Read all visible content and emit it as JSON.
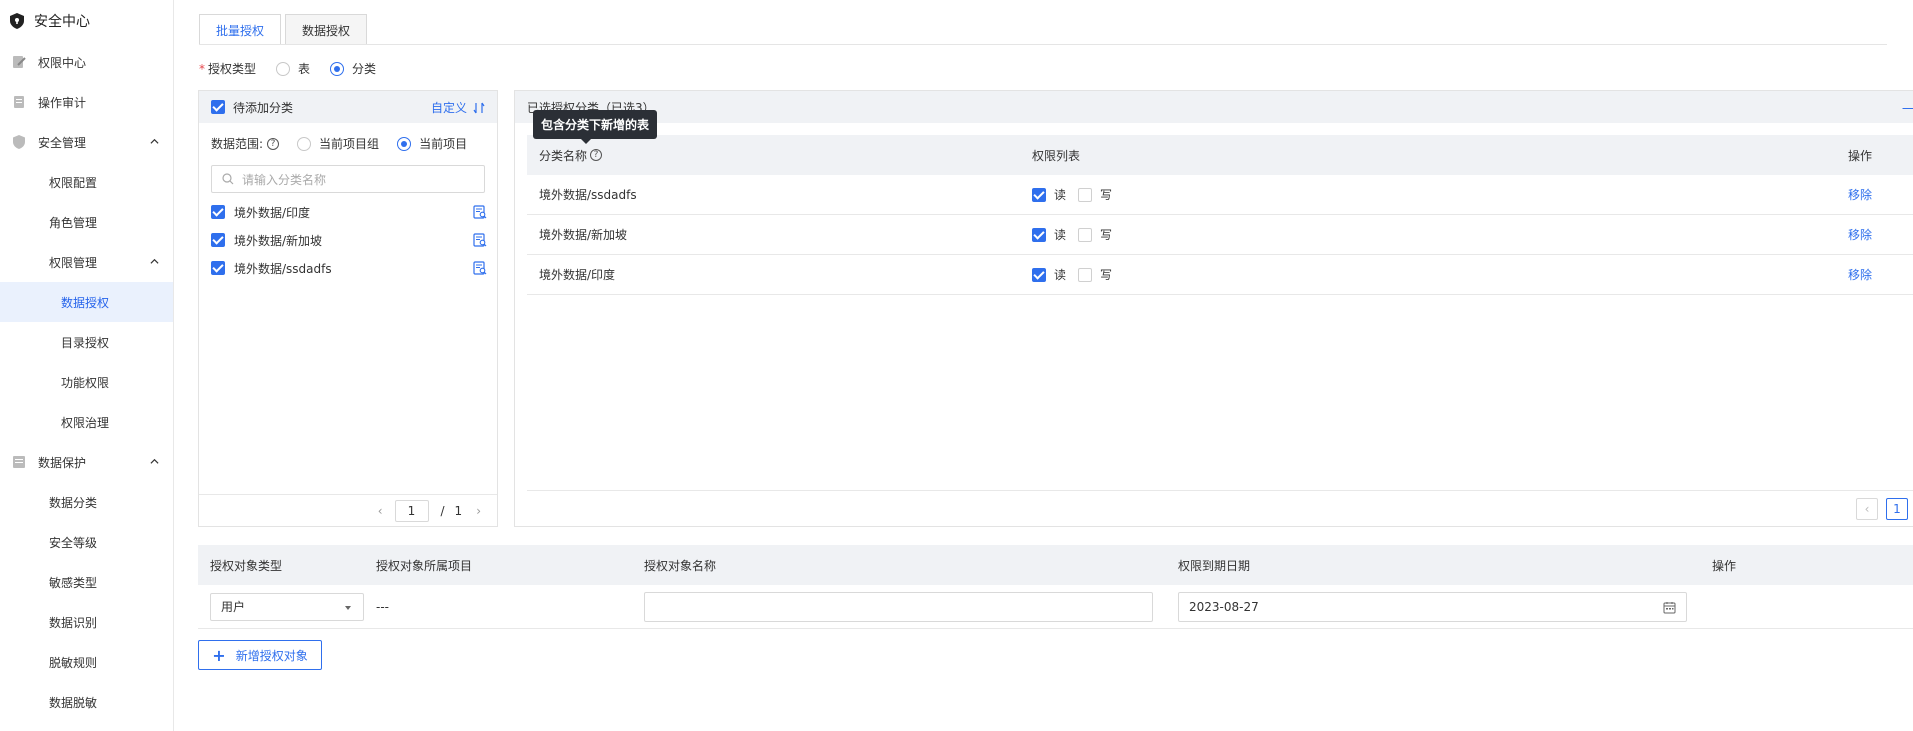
{
  "sidebar": {
    "title": "安全中心",
    "items": [
      {
        "label": "权限中心"
      },
      {
        "label": "操作审计"
      },
      {
        "label": "安全管理"
      },
      {
        "label": "权限配置"
      },
      {
        "label": "角色管理"
      },
      {
        "label": "权限管理"
      },
      {
        "label": "数据授权"
      },
      {
        "label": "目录授权"
      },
      {
        "label": "功能权限"
      },
      {
        "label": "权限治理"
      },
      {
        "label": "数据保护"
      },
      {
        "label": "数据分类"
      },
      {
        "label": "安全等级"
      },
      {
        "label": "敏感类型"
      },
      {
        "label": "数据识别"
      },
      {
        "label": "脱敏规则"
      },
      {
        "label": "数据脱敏"
      }
    ]
  },
  "tabs": [
    {
      "label": "批量授权"
    },
    {
      "label": "数据授权"
    }
  ],
  "auth_type": {
    "required": "*",
    "label": "授权类型",
    "opt_table": "表",
    "opt_category": "分类",
    "selected": "分类"
  },
  "left_panel": {
    "title": "待添加分类",
    "custom": "自定义",
    "scope_label": "数据范围:",
    "scope_qmark": "?",
    "scope_opt1": "当前项目组",
    "scope_opt2": "当前项目",
    "search_placeholder": "请输入分类名称",
    "items": [
      {
        "label": "境外数据/印度"
      },
      {
        "label": "境外数据/新加坡"
      },
      {
        "label": "境外数据/ssdadfs"
      }
    ],
    "page": "1",
    "page_sep": "/",
    "page_total": "1"
  },
  "right_panel": {
    "title": "已选授权分类（已选3）",
    "clear": "一键清空",
    "tooltip": "包含分类下新增的表",
    "headers": {
      "name": "分类名称",
      "qmark": "?",
      "perms": "权限列表",
      "action": "操作"
    },
    "read_label": "读",
    "write_label": "写",
    "remove_label": "移除",
    "rows": [
      {
        "name": "境外数据/ssdadfs"
      },
      {
        "name": "境外数据/新加坡"
      },
      {
        "name": "境外数据/印度"
      }
    ],
    "page": "1"
  },
  "bottom_table": {
    "headers": {
      "type": "授权对象类型",
      "project": "授权对象所属项目",
      "name": "授权对象名称",
      "expire": "权限到期日期",
      "action": "操作"
    },
    "row": {
      "type": "用户",
      "project": "---",
      "name": "",
      "expire": "2023-08-27"
    }
  },
  "add_button": {
    "plus": "+",
    "label": "新增授权对象"
  },
  "colors": {
    "primary": "#2f6fed",
    "header_bg": "#f0f2f5",
    "active_bg": "#eaf1fd"
  }
}
